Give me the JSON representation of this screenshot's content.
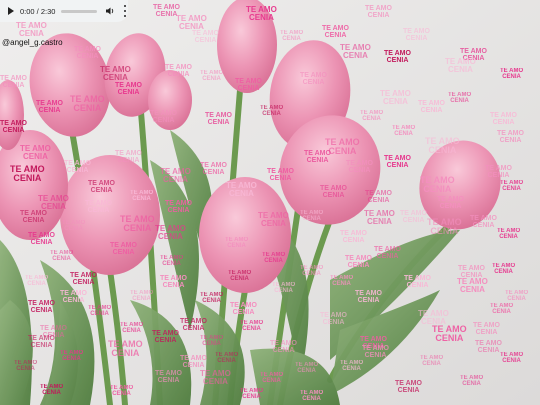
{
  "audio_player": {
    "time_display": "0:00 / 2:30",
    "progress": 0.0,
    "icons": {
      "play": "play-icon",
      "volume": "volume-icon",
      "more": "more-vert-icon"
    }
  },
  "username": "@angel_g.castro",
  "overlay_text": {
    "line1": "TE AMO",
    "line2": "CENIA",
    "colors": [
      "#e7368d",
      "#ef5fa3",
      "#f48fbf",
      "#f9b8d6",
      "#c2185b"
    ]
  }
}
